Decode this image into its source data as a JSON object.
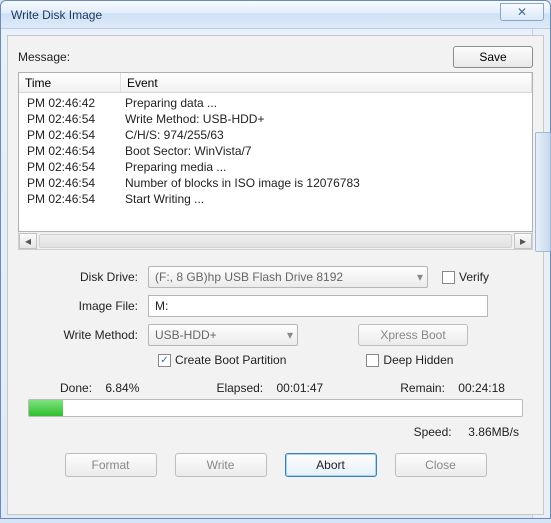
{
  "window": {
    "title": "Write Disk Image"
  },
  "topbar": {
    "message_label": "Message:",
    "save_label": "Save"
  },
  "log": {
    "col_time": "Time",
    "col_event": "Event",
    "rows": [
      {
        "time": "PM 02:46:42",
        "event": "Preparing data ..."
      },
      {
        "time": "PM 02:46:54",
        "event": "Write Method: USB-HDD+"
      },
      {
        "time": "PM 02:46:54",
        "event": "C/H/S: 974/255/63"
      },
      {
        "time": "PM 02:46:54",
        "event": "Boot Sector: WinVista/7"
      },
      {
        "time": "PM 02:46:54",
        "event": "Preparing media ..."
      },
      {
        "time": "PM 02:46:54",
        "event": "Number of blocks in ISO image is 12076783"
      },
      {
        "time": "PM 02:46:54",
        "event": "Start Writing ..."
      }
    ]
  },
  "form": {
    "disk_drive_label": "Disk Drive:",
    "disk_drive_value": "(F:, 8 GB)hp      USB Flash Drive 8192",
    "verify_label": "Verify",
    "image_file_label": "Image File:",
    "image_file_value": "M:",
    "write_method_label": "Write Method:",
    "write_method_value": "USB-HDD+",
    "xpress_label": "Xpress Boot",
    "create_boot_label": "Create Boot Partition",
    "deep_hidden_label": "Deep Hidden"
  },
  "stats": {
    "done_label": "Done:",
    "done_value": "6.84%",
    "elapsed_label": "Elapsed:",
    "elapsed_value": "00:01:47",
    "remain_label": "Remain:",
    "remain_value": "00:24:18",
    "speed_label": "Speed:",
    "speed_value": "3.86MB/s",
    "progress_percent": 6.84
  },
  "buttons": {
    "format": "Format",
    "write": "Write",
    "abort": "Abort",
    "close": "Close"
  }
}
